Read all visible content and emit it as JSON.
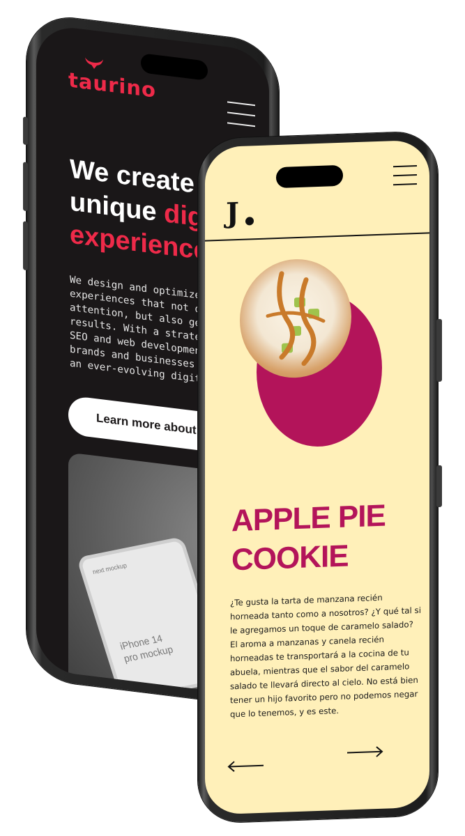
{
  "back_phone": {
    "logo": "taurino",
    "headline": {
      "line1": "We create",
      "line2_white": "unique ",
      "line2_red": "digi",
      "line3_red": "experience"
    },
    "body_lines": [
      "We design and optimize d",
      "experiences that not onl",
      "attention, but also gene",
      "results. With a strategi",
      "SEO and web development,",
      "brands and businesses st",
      "an ever-evolving digital"
    ],
    "cta_label": "Learn more about u",
    "mockup_card": {
      "caption_line1": "iPhone 14",
      "caption_line2": "pro mockup",
      "corner_text": "next mockup"
    },
    "accent_color": "#ee2a49",
    "background_color": "#1a1718"
  },
  "front_phone": {
    "logo": "J",
    "title_line1": "APPLE PIE",
    "title_line2": "COOKIE",
    "body_lines": [
      "¿Te gusta la tarta de manzana recién",
      "horneada tanto como a nosotros? ¿Y qué tal si",
      "le agregamos un toque de caramelo salado?",
      "El aroma a manzanas y canela recién",
      "horneadas te transportará a la cocina de tu",
      "abuela, mientras que el sabor del caramelo",
      "salado te llevará directo al cielo. No está bien",
      "tener un hijo favorito pero no podemos negar",
      "que lo tenemos, y es este."
    ],
    "icons": {
      "menu": "hamburger-icon",
      "prev": "arrow-left-icon",
      "next": "arrow-right-icon"
    },
    "accent_color": "#b3145a",
    "background_color": "#fff0b9"
  }
}
